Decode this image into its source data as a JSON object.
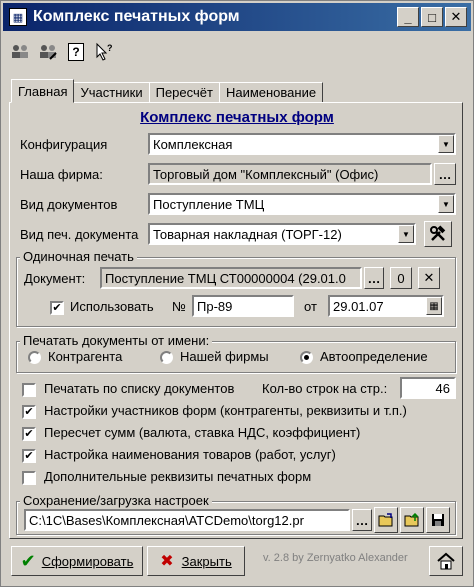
{
  "window": {
    "title": "Комплекс печатных форм",
    "controls": {
      "minimize": "_",
      "maximize": "□",
      "close": "✕"
    }
  },
  "toolbar": {
    "icons": [
      "users-icon",
      "users-edit-icon",
      "help-icon",
      "context-help-icon"
    ],
    "help_glyph": "?"
  },
  "tabs": [
    {
      "label": "Главная",
      "active": true
    },
    {
      "label": "Участники"
    },
    {
      "label": "Пересчёт"
    },
    {
      "label": "Наименование"
    }
  ],
  "main": {
    "heading": "Комплекс печатных форм",
    "config_label": "Конфигурация",
    "config_value": "Комплексная",
    "firm_label": "Наша фирма:",
    "firm_value": "Торговый дом \"Комплексный\" (Офис)",
    "doctype_label": "Вид документов",
    "doctype_value": "Поступление ТМЦ",
    "printtype_label": "Вид печ. документа",
    "printtype_value": "Товарная накладная (ТОРГ-12)"
  },
  "single_print": {
    "title": "Одиночная печать",
    "document_label": "Документ:",
    "document_value": "Поступление ТМЦ СТ00000004 (29.01.0",
    "browse_label": "...",
    "zero_label": "0",
    "clear_label": "✕",
    "use_label": "Использовать",
    "use_checked": true,
    "number_label": "№",
    "number_value": "Пр-89",
    "date_label": "от",
    "date_value": "29.01.07"
  },
  "print_from": {
    "title": "Печатать документы от имени:",
    "options": [
      {
        "label": "Контрагента",
        "selected": false
      },
      {
        "label": "Нашей фирмы",
        "selected": false
      },
      {
        "label": "Автоопределение",
        "selected": true
      }
    ]
  },
  "options": {
    "print_by_list": {
      "label": "Печатать по списку документов",
      "checked": false
    },
    "rows_label": "Кол-во строк на стр.:",
    "rows_value": "46",
    "participants": {
      "label": "Настройки участников форм (контрагенты, реквизиты и т.п.)",
      "checked": true
    },
    "recalc": {
      "label": "Пересчет сумм (валюта, ставка НДС, коэффициент)",
      "checked": true
    },
    "naming": {
      "label": "Настройка наименования товаров (работ, услуг)",
      "checked": true
    },
    "extra": {
      "label": "Дополнительные реквизиты печатных форм",
      "checked": false
    }
  },
  "settings_io": {
    "title": "Сохранение/загрузка настроек",
    "path_value": "C:\\1C\\Bases\\Комплексная\\ATCDemo\\torg12.pr",
    "browse_label": "..."
  },
  "footer": {
    "generate_label": "Сформировать",
    "close_label": "Закрыть",
    "version": "v. 2.8 by Zernyatko Alexander"
  },
  "glyphs": {
    "check": "✔",
    "cross": "✖",
    "dropdown": "▼"
  }
}
